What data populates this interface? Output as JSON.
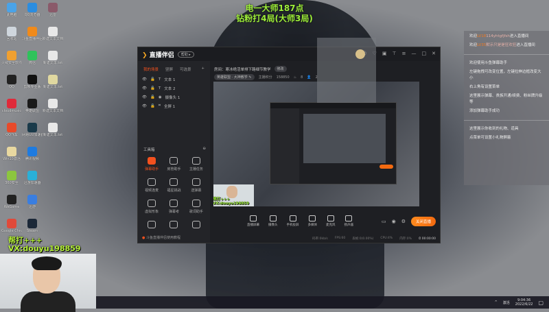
{
  "overlay_title": {
    "line1": "电一大师187点",
    "line2": "钻粉打4局(大师3局)"
  },
  "desktop_icons": [
    {
      "label": "此电脑",
      "color": "#4aa3e8"
    },
    {
      "label": "QQ浏览器",
      "color": "#2b8de0"
    },
    {
      "label": "迅雷",
      "color": "#8a5a6a"
    },
    {
      "label": "回收站",
      "color": "#cfd6dd"
    },
    {
      "label": "斗鱼直播伴侣",
      "color": "#f08a1a"
    },
    {
      "label": "新建文本文档.txt",
      "color": "#e8e8e8"
    },
    {
      "label": "火绒安全软件",
      "color": "#f0a030"
    },
    {
      "label": "微信",
      "color": "#2fc25b"
    },
    {
      "label": "新建文本.txt",
      "color": "#e8e8e8"
    },
    {
      "label": "QQ",
      "color": "#222"
    },
    {
      "label": "剪映专业版",
      "color": "#111"
    },
    {
      "label": "新建文本.txt",
      "color": "#e0d8a0"
    },
    {
      "label": "cloudmusic",
      "color": "#e02a3a"
    },
    {
      "label": "英雄联盟",
      "color": "#1a1a1a"
    },
    {
      "label": "新建文本文档.txt",
      "color": "#e8e8e8"
    },
    {
      "label": "QQ飞车",
      "color": "#e84a2a"
    },
    {
      "label": "网易UU加速器",
      "color": "#1a3a4a"
    },
    {
      "label": "新建文本.txt",
      "color": "#e8e8e8"
    },
    {
      "label": "Win10激活",
      "color": "#e8d8a0"
    },
    {
      "label": "腾讯视频",
      "color": "#1e7be0"
    },
    {
      "label": "",
      "color": "transparent"
    },
    {
      "label": "360安全",
      "color": "#8cc63f"
    },
    {
      "label": "迅游加速器",
      "color": "#2ab0d8"
    },
    {
      "label": "",
      "color": "transparent"
    },
    {
      "label": "WeGame",
      "color": "#222"
    },
    {
      "label": "迅游",
      "color": "#3a7ee0"
    },
    {
      "label": "",
      "color": "transparent"
    },
    {
      "label": "Google Chrome",
      "color": "#e04a3a"
    },
    {
      "label": "Steam",
      "color": "#1b2838"
    },
    {
      "label": "",
      "color": "transparent"
    }
  ],
  "app": {
    "name": "直播伴侣",
    "pill": "帮助 ▸",
    "window_buttons": [
      "☺",
      "♡",
      "▣",
      "⊤",
      "≡",
      "—",
      "□",
      "✕"
    ],
    "scene_tabs": [
      "我的场景",
      "竖屏",
      "可选景",
      "+"
    ],
    "sources": [
      {
        "icon": "T",
        "label": "文本 1"
      },
      {
        "icon": "T",
        "label": "文本 2"
      },
      {
        "icon": "◉",
        "label": "摄像头 1"
      },
      {
        "icon": "⌗",
        "label": "全屏 1"
      }
    ],
    "tools_title": "工具箱",
    "tools": [
      "弹幕助手",
      "房管助手",
      "主播任务",
      "视频连麦",
      "福星挑战",
      "送弹幕",
      "虚拟形象",
      "弹幕考",
      "歌词助手",
      "",
      "",
      ""
    ],
    "tutorial": "斗鱼直播伴侣使用教程",
    "room_title": "房间：寒冰绝活单排下路细节教学",
    "edit": "修改",
    "category": "英雄联盟 · 大神教学 ✎",
    "score_label": "主播积分",
    "score": "158850",
    "fans": "8",
    "viewers": "2",
    "toolbar": [
      "直播屏幕",
      "摄像头",
      "手机投屏",
      "多媒体",
      "麦克风",
      "扬声器"
    ],
    "stop_live": "关闭直播",
    "status": {
      "bitrate": "码率:0kb/s",
      "fps": "FPS:60",
      "drop": "丢帧:0(0.00%)",
      "cpu": "CPU:4%",
      "mem": "内存:0%",
      "time": "⏱ 00:00:00"
    },
    "cam_thumb_text": "帮打+++ VX:douyu198859"
  },
  "chat": {
    "entries": [
      {
        "pre": "欢迎",
        "lv": "LV18",
        "name": "114yhtgfjfsh",
        "post": "进入直播间"
      },
      {
        "pre": "欢迎",
        "lv": "LV35",
        "name": "默示只是是狂欢狂",
        "post": "进入直播间"
      }
    ],
    "system": [
      "欢迎使用斗鱼弹幕助手",
      "左键拖拽可改变位置，左键拉伸边框改变大小",
      "右上角有设置菜单",
      "这里展示弹幕、贵族开通/续费、粉丝牌升级等",
      "添加弹幕助手成功"
    ],
    "gifts": [
      "这里展示你收到的礼物、道具",
      "点菜单可设置小礼物屏蔽"
    ]
  },
  "webcam_overlay": {
    "line1": "帮打+++",
    "line2": "VX:douyu198859"
  },
  "taskbar": {
    "tray": "^",
    "ime": "激活",
    "time": "9:04:36",
    "date": "2022/6/22",
    "notify": "▢"
  }
}
